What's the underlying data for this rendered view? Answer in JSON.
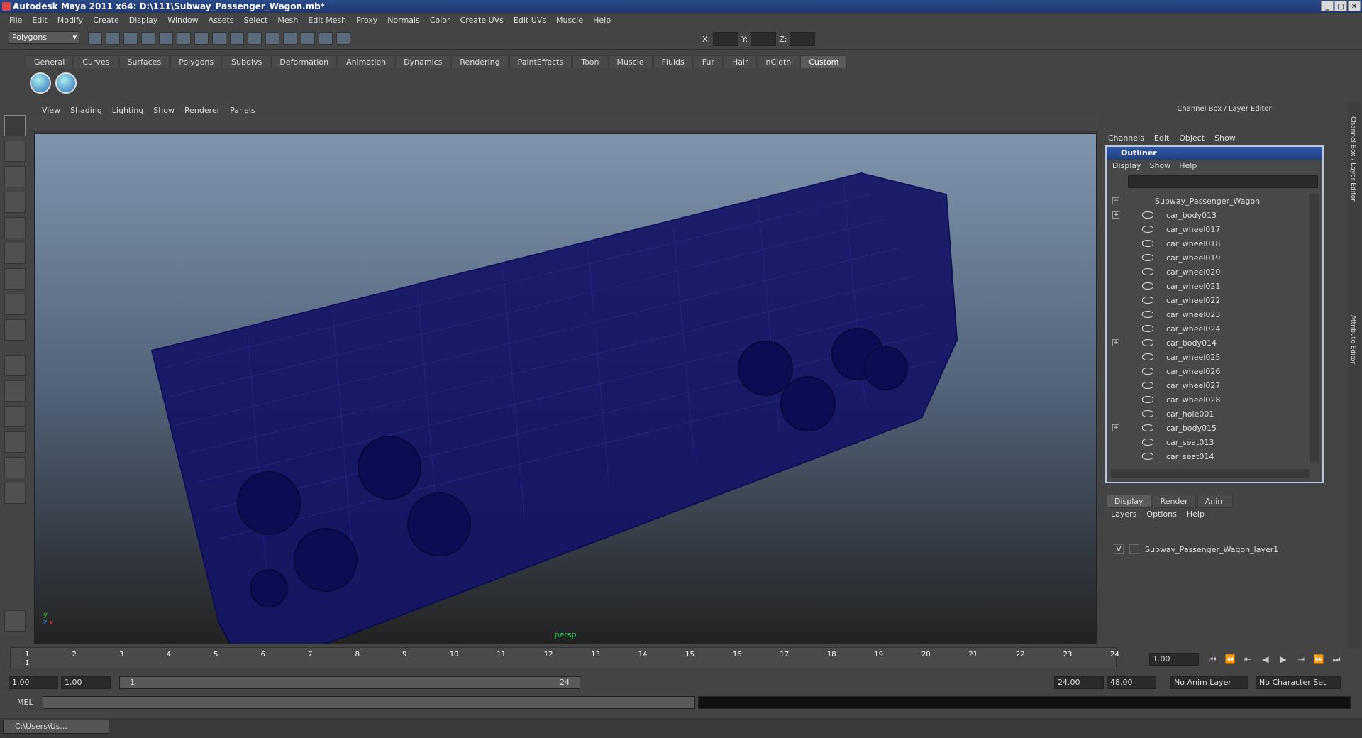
{
  "window": {
    "title": "Autodesk Maya 2011 x64: D:\\111\\Subway_Passenger_Wagon.mb*",
    "controls": [
      "_",
      "□",
      "✕"
    ]
  },
  "menubar": [
    "File",
    "Edit",
    "Modify",
    "Create",
    "Display",
    "Window",
    "Assets",
    "Select",
    "Mesh",
    "Edit Mesh",
    "Proxy",
    "Normals",
    "Color",
    "Create UVs",
    "Edit UVs",
    "Muscle",
    "Help"
  ],
  "status": {
    "mode": "Polygons",
    "x_label": "X:",
    "y_label": "Y:",
    "z_label": "Z:"
  },
  "shelf": {
    "tabs": [
      "General",
      "Curves",
      "Surfaces",
      "Polygons",
      "Subdivs",
      "Deformation",
      "Animation",
      "Dynamics",
      "Rendering",
      "PaintEffects",
      "Toon",
      "Muscle",
      "Fluids",
      "Fur",
      "Hair",
      "nCloth",
      "Custom"
    ],
    "active": "Custom"
  },
  "panel": {
    "menu": [
      "View",
      "Shading",
      "Lighting",
      "Show",
      "Renderer",
      "Panels"
    ],
    "camera_label": "persp",
    "axis_y": "y",
    "axis_x": "x",
    "axis_z": "z"
  },
  "channelbox": {
    "title": "Channel Box / Layer Editor",
    "menu": [
      "Channels",
      "Edit",
      "Object",
      "Show"
    ],
    "side_tabs": [
      "Channel Box / Layer Editor",
      "Attribute Editor"
    ]
  },
  "outliner": {
    "title": "Outliner",
    "menu": [
      "Display",
      "Show",
      "Help"
    ],
    "root": "Subway_Passenger_Wagon",
    "items": [
      {
        "name": "car_body013",
        "expand": "+"
      },
      {
        "name": "car_wheel017",
        "expand": ""
      },
      {
        "name": "car_wheel018",
        "expand": ""
      },
      {
        "name": "car_wheel019",
        "expand": ""
      },
      {
        "name": "car_wheel020",
        "expand": ""
      },
      {
        "name": "car_wheel021",
        "expand": ""
      },
      {
        "name": "car_wheel022",
        "expand": ""
      },
      {
        "name": "car_wheel023",
        "expand": ""
      },
      {
        "name": "car_wheel024",
        "expand": ""
      },
      {
        "name": "car_body014",
        "expand": "+"
      },
      {
        "name": "car_wheel025",
        "expand": ""
      },
      {
        "name": "car_wheel026",
        "expand": ""
      },
      {
        "name": "car_wheel027",
        "expand": ""
      },
      {
        "name": "car_wheel028",
        "expand": ""
      },
      {
        "name": "car_hole001",
        "expand": ""
      },
      {
        "name": "car_body015",
        "expand": "+"
      },
      {
        "name": "car_seat013",
        "expand": ""
      },
      {
        "name": "car_seat014",
        "expand": ""
      }
    ]
  },
  "layers": {
    "tabs": [
      "Display",
      "Render",
      "Anim"
    ],
    "active": "Display",
    "menu": [
      "Layers",
      "Options",
      "Help"
    ],
    "visibility": "V",
    "layer_name": "Subway_Passenger_Wagon_layer1"
  },
  "timeline": {
    "ticks": [
      "1",
      "2",
      "3",
      "4",
      "5",
      "6",
      "7",
      "8",
      "9",
      "10",
      "11",
      "12",
      "13",
      "14",
      "15",
      "16",
      "17",
      "18",
      "19",
      "20",
      "21",
      "22",
      "23",
      "24"
    ],
    "start_marker": "1",
    "current_frame": "1.00"
  },
  "range": {
    "start": "1.00",
    "playback_start": "1.00",
    "range_start": "1",
    "range_end": "24",
    "playback_end": "24.00",
    "end": "48.00",
    "anim_layer": "No Anim Layer",
    "character_set": "No Character Set"
  },
  "cmd": {
    "label": "MEL"
  },
  "taskbar": {
    "item": "C:\\Users\\Us..."
  },
  "colors": {
    "wire": "#101070",
    "title": "#1d3870"
  }
}
